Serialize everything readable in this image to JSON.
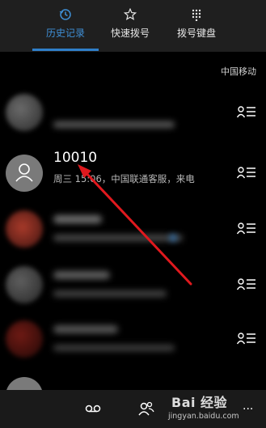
{
  "tabs": [
    {
      "label": "历史记录",
      "icon": "history-icon",
      "active": true
    },
    {
      "label": "快速拨号",
      "icon": "star-icon",
      "active": false
    },
    {
      "label": "拨号键盘",
      "icon": "keypad-icon",
      "active": false
    }
  ],
  "carrier": "中国移动",
  "call_history": [
    {
      "number": "10010",
      "detail": "周三 15:06，中国联通客服，来电"
    }
  ],
  "bottom_bar": {
    "icons": [
      "voicemail-icon",
      "contacts-icon",
      "more-icon"
    ],
    "more_label": "..."
  },
  "watermark": {
    "brand": "Bai 经验",
    "url": "jingyan.baidu.com"
  },
  "colors": {
    "accent": "#2f7fc9",
    "topbar": "#1f1f1f",
    "background": "#000000",
    "annotation_arrow": "#e0191e"
  }
}
